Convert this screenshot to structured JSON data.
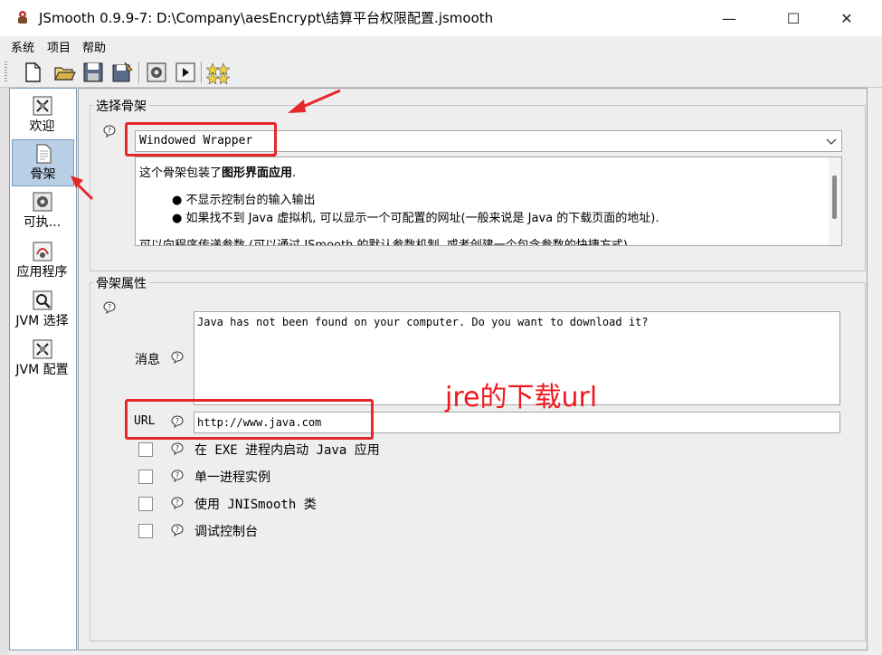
{
  "window": {
    "title": "JSmooth 0.9.9-7: D:\\Company\\aesEncrypt\\结算平台权限配置.jsmooth",
    "minimize_glyph": "—",
    "maximize_glyph": "☐",
    "close_glyph": "✕"
  },
  "menu": [
    "系统",
    "项目",
    "帮助"
  ],
  "toolbar": {
    "buttons": [
      "new-icon",
      "open-icon",
      "save-icon",
      "save-as-icon",
      "compile-icon",
      "run-icon",
      "about-icon"
    ]
  },
  "sidebar": {
    "items": [
      {
        "label": "欢迎",
        "icon": "welcome-icon"
      },
      {
        "label": "骨架",
        "icon": "skeleton-icon",
        "selected": true
      },
      {
        "label": "可执...",
        "icon": "executable-icon"
      },
      {
        "label": "应用程序",
        "icon": "application-icon"
      },
      {
        "label": "JVM 选择",
        "icon": "jvm-select-icon"
      },
      {
        "label": "JVM 配置",
        "icon": "jvm-config-icon"
      }
    ]
  },
  "skeleton_group": {
    "title": "选择骨架",
    "selected_skeleton": "Windowed Wrapper",
    "description": {
      "intro_prefix": "这个骨架包装了",
      "intro_bold": "图形界面应用",
      "intro_suffix": ".",
      "bullets": [
        "不显示控制台的输入输出",
        "如果找不到 Java 虚拟机, 可以显示一个可配置的网址(一般来说是 Java 的下载页面的地址)."
      ],
      "partial_line": "可以向程序传递参数 (可以通过 JSmooth 的默认参数机制, 或者创建一个包含参数的快捷方式)."
    }
  },
  "properties_group": {
    "title": "骨架属性",
    "message_label": "消息",
    "message_value": "Java has not been found on your computer. Do you want to download it?",
    "url_label": "URL",
    "url_value": "http://www.java.com",
    "checkboxes": [
      {
        "label": "在 EXE 进程内启动 Java 应用",
        "checked": false
      },
      {
        "label": "单一进程实例",
        "checked": false
      },
      {
        "label": "使用 JNISmooth 类",
        "checked": false
      },
      {
        "label": "调试控制台",
        "checked": false
      }
    ]
  },
  "annotation": {
    "text": "jre的下载url",
    "color": "#e8262a"
  }
}
